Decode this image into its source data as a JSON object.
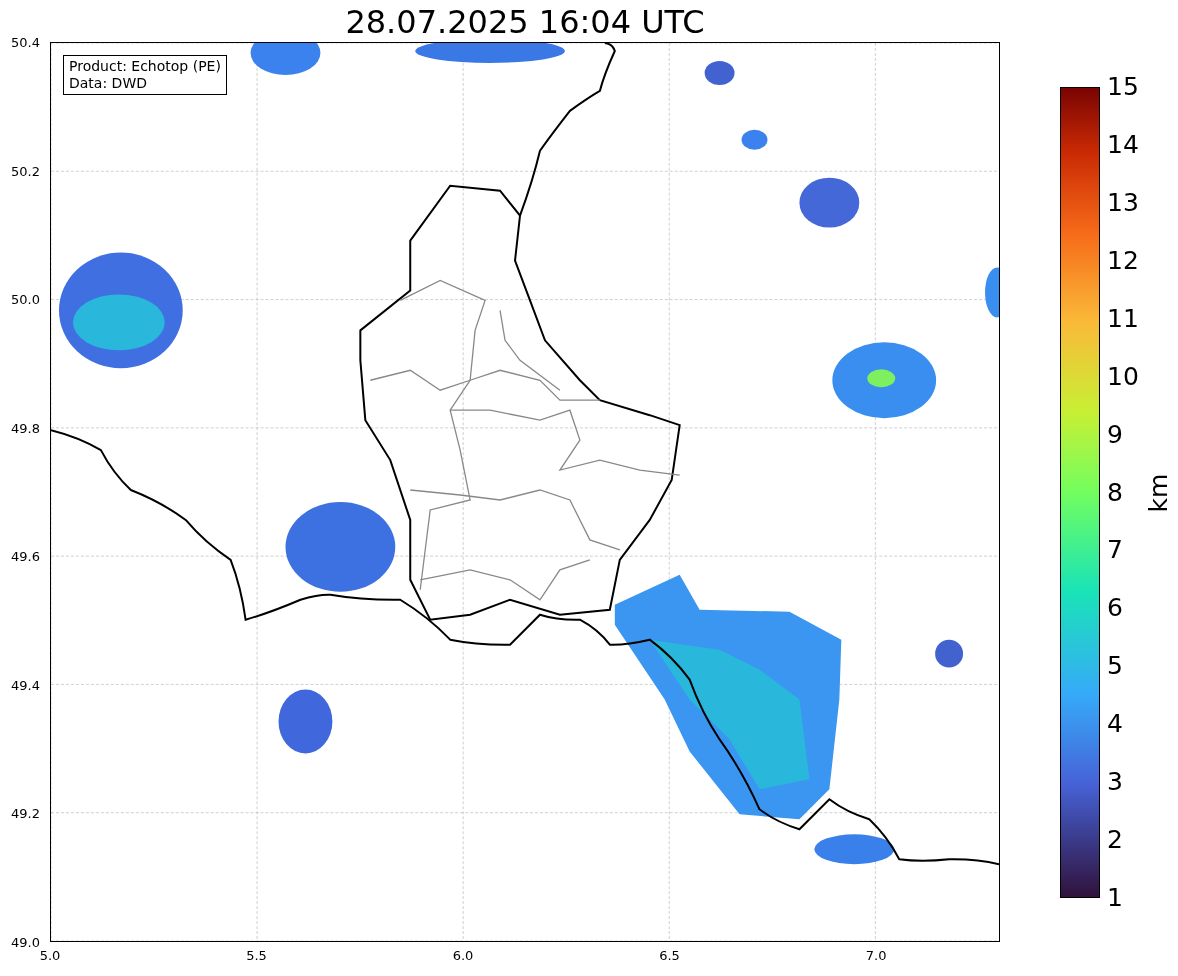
{
  "title": "28.07.2025 16:04 UTC",
  "info_box": [
    "Product: Echotop (PE)",
    "Data: DWD"
  ],
  "x_axis_ticks": [
    "5.0",
    "5.5",
    "6.0",
    "6.5",
    "7.0"
  ],
  "y_axis_ticks": [
    "50.4",
    "50.2",
    "50.0",
    "49.8",
    "49.6",
    "49.4",
    "49.2",
    "49.0"
  ],
  "colorbar": {
    "ticks": [
      "15",
      "14",
      "13",
      "12",
      "11",
      "10",
      "9",
      "8",
      "7",
      "6",
      "5",
      "4",
      "3",
      "2",
      "1"
    ],
    "label": "km"
  }
}
